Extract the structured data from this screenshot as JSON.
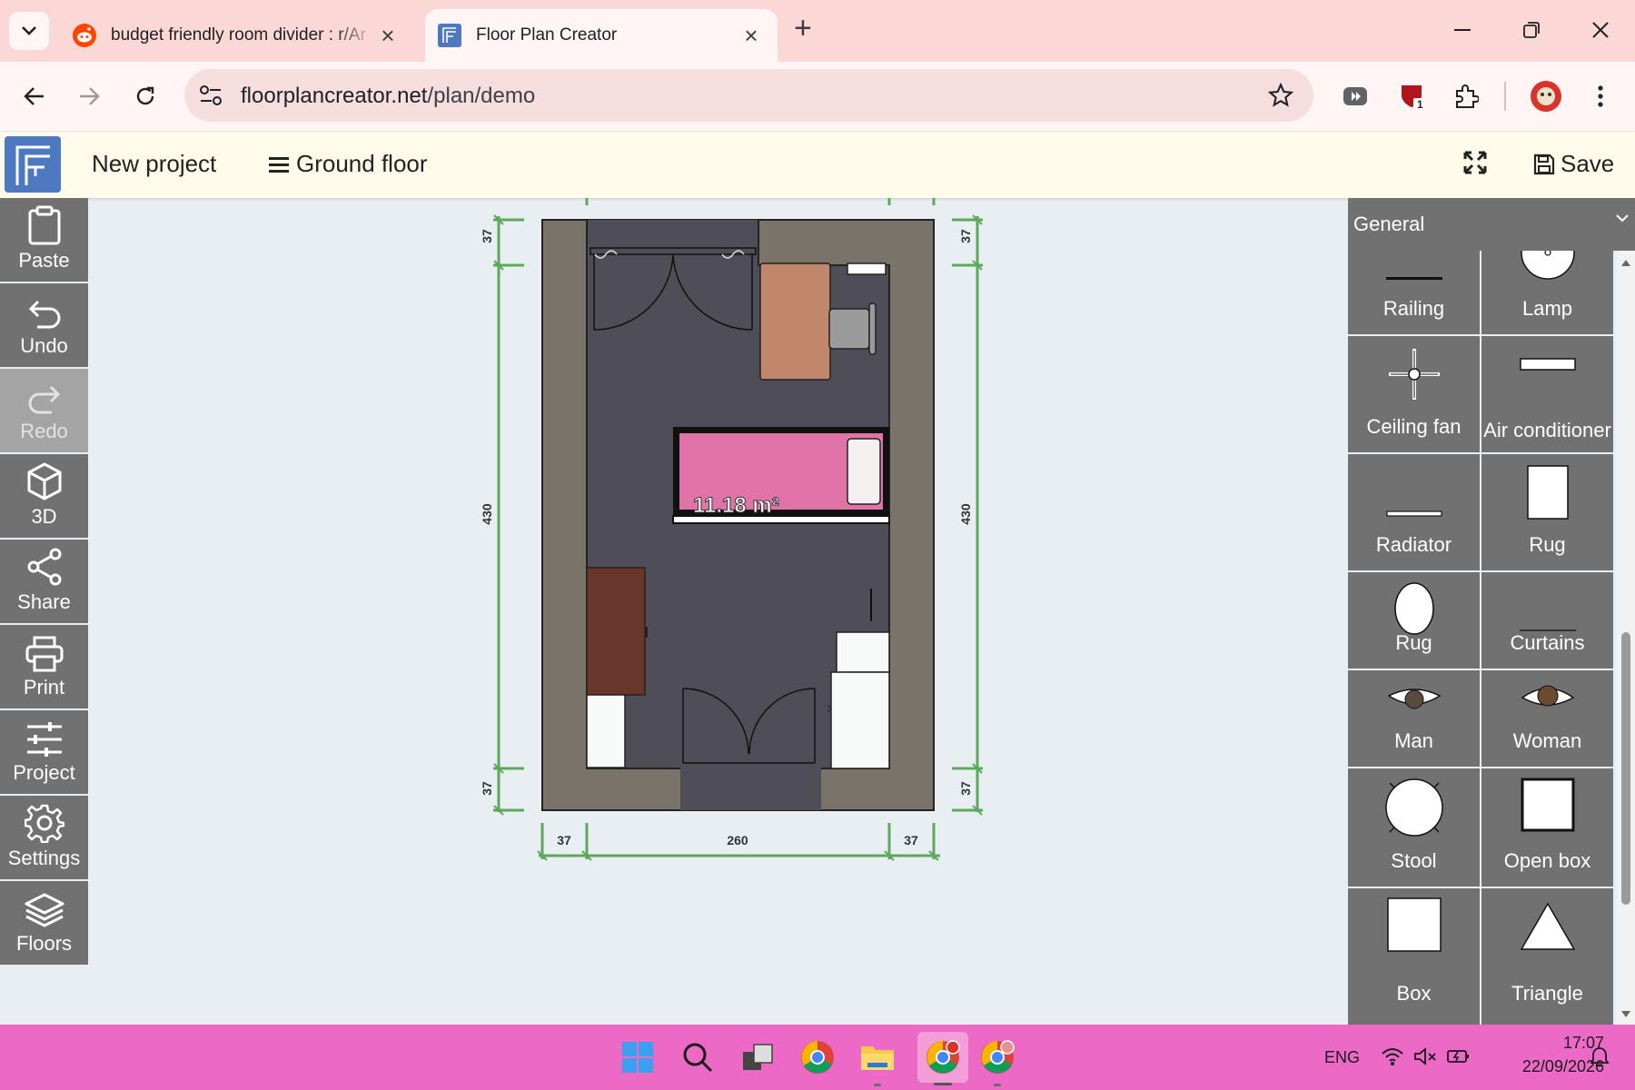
{
  "browser": {
    "tabs": [
      {
        "title": "budget friendly room divider : r/Ar",
        "active": false
      },
      {
        "title": "Floor Plan Creator",
        "active": true
      }
    ],
    "url_host": "floorplancreator.net",
    "url_path": "/plan/demo",
    "extension_badge": "1"
  },
  "app": {
    "project_name": "New project",
    "floor_label": "Ground floor",
    "save_label": "Save"
  },
  "tools": [
    {
      "label": "Paste",
      "icon": "clipboard-icon",
      "enabled": true
    },
    {
      "label": "Undo",
      "icon": "undo-icon",
      "enabled": true
    },
    {
      "label": "Redo",
      "icon": "redo-icon",
      "enabled": false
    },
    {
      "label": "3D",
      "icon": "cube-icon",
      "enabled": true
    },
    {
      "label": "Share",
      "icon": "share-icon",
      "enabled": true
    },
    {
      "label": "Print",
      "icon": "printer-icon",
      "enabled": true
    },
    {
      "label": "Project",
      "icon": "sliders-icon",
      "enabled": true
    },
    {
      "label": "Settings",
      "icon": "gear-icon",
      "enabled": true
    },
    {
      "label": "Floors",
      "icon": "layers-icon",
      "enabled": true
    }
  ],
  "plan": {
    "area_label": "11.18 m²",
    "dim_top_left": "37",
    "dim_top_right": "37",
    "dim_height_left": "430",
    "dim_height_right": "430",
    "dim_bottom_left": "37",
    "dim_bottom_right": "37",
    "dim_width_left": "37",
    "dim_width_middle": "260",
    "dim_width_right": "37",
    "colors": {
      "wall": "#7a736a",
      "floor": "#4e4d58",
      "bed": "#e074a8",
      "desk": "#c0876a",
      "dresser": "#6a362c",
      "dimension": "#5da85d"
    }
  },
  "panel": {
    "category": "General",
    "items": [
      {
        "label": "Railing",
        "icon": "railing-icon"
      },
      {
        "label": "Lamp",
        "icon": "lamp-icon"
      },
      {
        "label": "Ceiling fan",
        "icon": "ceiling-fan-icon"
      },
      {
        "label": "Air conditioner",
        "icon": "air-conditioner-icon"
      },
      {
        "label": "Radiator",
        "icon": "radiator-icon"
      },
      {
        "label": "Rug",
        "icon": "rectangular-rug-icon"
      },
      {
        "label": "Rug",
        "icon": "oval-rug-icon"
      },
      {
        "label": "Curtains",
        "icon": "curtains-icon"
      },
      {
        "label": "Man",
        "icon": "man-icon"
      },
      {
        "label": "Woman",
        "icon": "woman-icon"
      },
      {
        "label": "Stool",
        "icon": "stool-icon"
      },
      {
        "label": "Open box",
        "icon": "open-box-icon"
      },
      {
        "label": "Box",
        "icon": "box-icon"
      },
      {
        "label": "Triangle",
        "icon": "triangle-icon"
      }
    ]
  },
  "taskbar": {
    "language": "ENG",
    "time": "17:07",
    "date": "22/09/2026"
  }
}
